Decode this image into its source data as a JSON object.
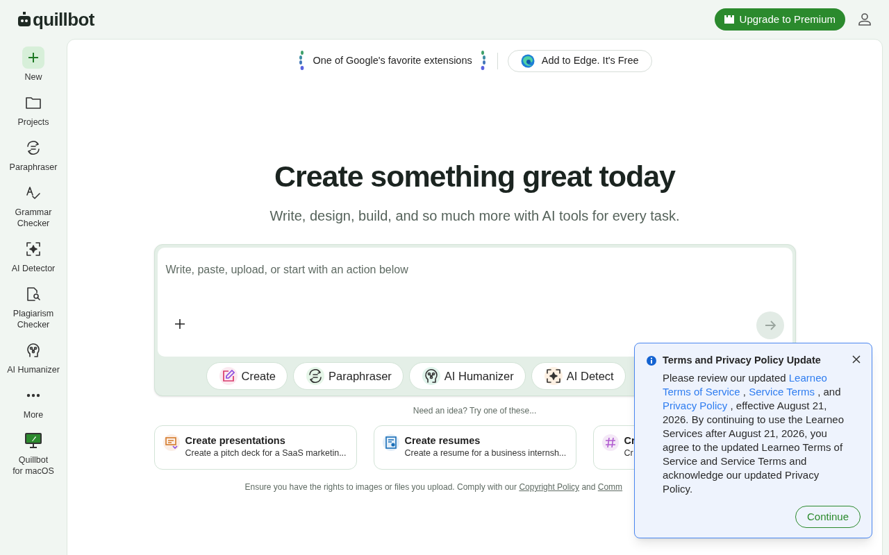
{
  "header": {
    "logo": "quillbot",
    "upgrade_button": "Upgrade to Premium"
  },
  "sidebar": {
    "items": [
      {
        "label": "New",
        "selected": true
      },
      {
        "label": "Projects",
        "selected": false
      },
      {
        "label": "Paraphraser",
        "selected": false
      },
      {
        "label": "Grammar\nChecker",
        "selected": false
      },
      {
        "label": "AI Detector",
        "selected": false
      },
      {
        "label": "Plagiarism\nChecker",
        "selected": false
      },
      {
        "label": "AI Humanizer",
        "selected": false
      },
      {
        "label": "More",
        "selected": false
      },
      {
        "label": "Quillbot\nfor macOS",
        "selected": false
      }
    ]
  },
  "banner": {
    "text": "One of Google's favorite extensions",
    "button": "Add to Edge. It's Free"
  },
  "hero": {
    "title": "Create something great today",
    "subtitle": "Write, design, build, and so much more with AI tools for every task."
  },
  "composer": {
    "placeholder": "Write, paste, upload, or start with an action below"
  },
  "actions": [
    {
      "label": "Create"
    },
    {
      "label": "Paraphraser"
    },
    {
      "label": "AI Humanizer"
    },
    {
      "label": "AI Detect"
    }
  ],
  "ideas": {
    "prompt": "Need an idea? Try one of these...",
    "cards": [
      {
        "title": "Create presentations",
        "description": "Create a pitch deck for a SaaS marketin..."
      },
      {
        "title": "Create resumes",
        "description": "Create a resume for a business internsh..."
      },
      {
        "title": "Cr",
        "description": "Cr"
      }
    ]
  },
  "footer_note": {
    "text": "Ensure you have the rights to images or files you upload. Comply with our",
    "link1": "Copyright Policy",
    "joiner": "and",
    "link2": "Comm"
  },
  "dialog": {
    "title": "Terms and Privacy Policy Update",
    "body": [
      "Please review our updated ",
      {
        "link": "Learneo"
      },
      {
        "link": "Terms of Service"
      },
      " , ",
      {
        "link": "Service Terms"
      },
      " , and ",
      {
        "link": "Privacy Policy"
      },
      " , effective August 21, 2026. By continuing to use the Learneo Services after August 21, 2026, you agree to the updated Learneo Terms of Service and Service Terms and acknowledge our updated Privacy Policy."
    ],
    "button": "Continue"
  }
}
